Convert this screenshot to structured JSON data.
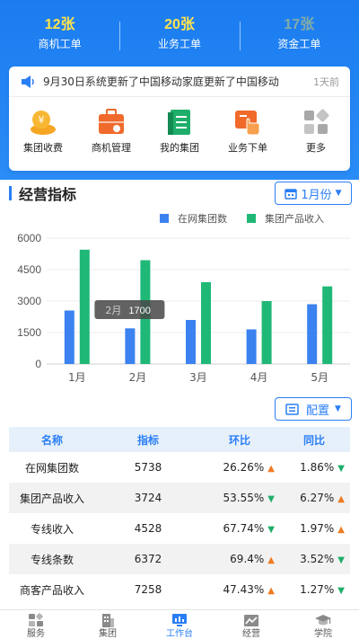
{
  "stats": [
    {
      "value": "12张",
      "label": "商机工单"
    },
    {
      "value": "20张",
      "label": "业务工单"
    },
    {
      "value": "17张",
      "label": "资金工单"
    }
  ],
  "notice": {
    "text": "9月30日系统更新了中国移动家庭更新了中国移动",
    "time": "1天前"
  },
  "quick_menu": [
    {
      "label": "集团收费",
      "icon": "group-fee-icon",
      "color": "#f5a623"
    },
    {
      "label": "商机管理",
      "icon": "briefcase-icon",
      "color": "#f06a2c"
    },
    {
      "label": "我的集团",
      "icon": "document-icon",
      "color": "#1fae6a"
    },
    {
      "label": "业务下单",
      "icon": "hand-tap-icon",
      "color": "#f06a2c"
    },
    {
      "label": "更多",
      "icon": "more-grid-icon",
      "color": "#999999"
    }
  ],
  "section": {
    "title": "经营指标",
    "month_select": "1月份",
    "config_select": "配置"
  },
  "chart_data": {
    "type": "bar",
    "categories": [
      "1月",
      "2月",
      "3月",
      "4月",
      "5月"
    ],
    "series": [
      {
        "name": "在网集团数",
        "color": "#3b82f0",
        "values": [
          2550,
          1700,
          2100,
          1650,
          2850
        ]
      },
      {
        "name": "集团产品收入",
        "color": "#1fb877",
        "values": [
          5450,
          4950,
          3900,
          3000,
          3700
        ]
      }
    ],
    "yticks": [
      0,
      1500,
      3000,
      4500,
      6000
    ],
    "ylim": [
      0,
      6000
    ],
    "tooltip": {
      "category": "2月",
      "value": "1700"
    }
  },
  "table": {
    "headers": [
      "名称",
      "指标",
      "环比",
      "同比"
    ],
    "rows": [
      {
        "name": "在网集团数",
        "value": "5738",
        "mom": "26.26%",
        "mom_dir": "up",
        "yoy": "1.86%",
        "yoy_dir": "down"
      },
      {
        "name": "集团产品收入",
        "value": "3724",
        "mom": "53.55%",
        "mom_dir": "down",
        "yoy": "6.27%",
        "yoy_dir": "up"
      },
      {
        "name": "专线收入",
        "value": "4528",
        "mom": "67.74%",
        "mom_dir": "down",
        "yoy": "1.97%",
        "yoy_dir": "up"
      },
      {
        "name": "专线条数",
        "value": "6372",
        "mom": "69.4%",
        "mom_dir": "up",
        "yoy": "3.52%",
        "yoy_dir": "down"
      },
      {
        "name": "商客产品收入",
        "value": "7258",
        "mom": "47.43%",
        "mom_dir": "up",
        "yoy": "1.27%",
        "yoy_dir": "down"
      }
    ]
  },
  "tabbar": [
    {
      "label": "服务",
      "icon": "service-icon"
    },
    {
      "label": "集团",
      "icon": "building-icon"
    },
    {
      "label": "工作台",
      "icon": "workbench-icon",
      "active": true
    },
    {
      "label": "经营",
      "icon": "business-chart-icon"
    },
    {
      "label": "学院",
      "icon": "graduation-cap-icon"
    }
  ],
  "colors": {
    "primary": "#2a7ef5",
    "accent_yellow": "#ffe34d",
    "up": "#ef7a21",
    "down": "#1fae6a"
  }
}
